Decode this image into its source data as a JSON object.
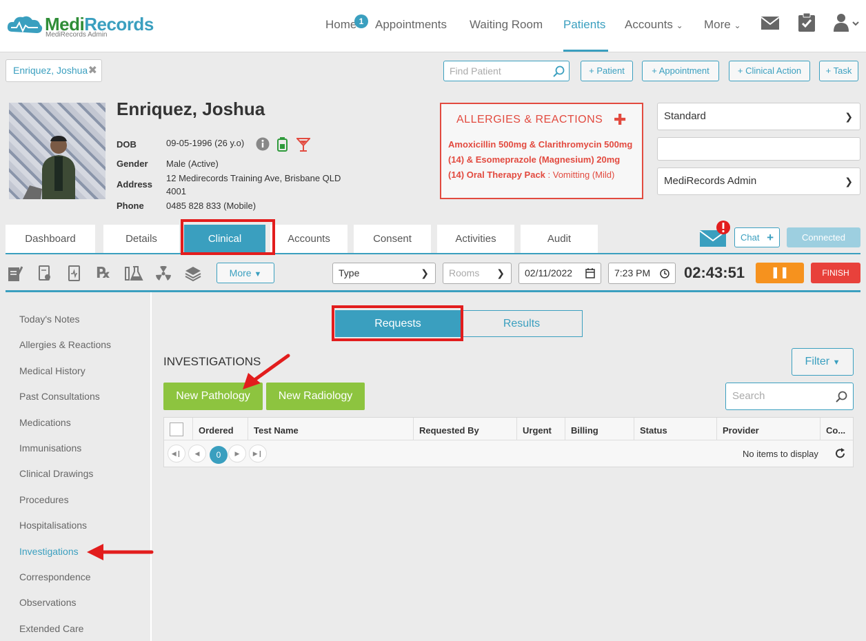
{
  "brand": {
    "name_part1": "Medi",
    "name_part2": "Records",
    "subtitle": "MediRecords Admin"
  },
  "nav": {
    "home": "Home",
    "home_badge": "1",
    "appointments": "Appointments",
    "waiting_room": "Waiting Room",
    "patients": "Patients",
    "accounts": "Accounts",
    "more": "More"
  },
  "toolbar": {
    "patient_tab": "Enriquez, Joshua",
    "find_patient_placeholder": "Find Patient",
    "add_patient": "+ Patient",
    "add_appointment": "+ Appointment",
    "add_clinical_action": "+ Clinical Action",
    "add_task": "+ Task"
  },
  "patient": {
    "name": "Enriquez, Joshua",
    "dob_label": "DOB",
    "dob": "09-05-1996 (26 y.o)",
    "gender_label": "Gender",
    "gender": "Male (Active)",
    "address_label": "Address",
    "address_line1": "12 Medirecords Training Ave, Brisbane QLD",
    "address_line2": "4001",
    "phone_label": "Phone",
    "phone": "0485 828 833 (Mobile)"
  },
  "allergies": {
    "title": "ALLERGIES & REACTIONS",
    "drug": "Amoxicillin 500mg & Clarithromycin 500mg (14) & Esomeprazole (Magnesium) 20mg (14) Oral Therapy Pack",
    "reaction": " : Vomitting (Mild)"
  },
  "right_selects": {
    "billing_type": "Standard",
    "blank": "",
    "provider": "MediRecords Admin"
  },
  "tabs": [
    "Dashboard",
    "Details",
    "Clinical",
    "Accounts",
    "Consent",
    "Activities",
    "Audit"
  ],
  "chat": {
    "label": "Chat",
    "connected": "Connected"
  },
  "clinical_toolbar": {
    "more": "More",
    "type": "Type",
    "rooms": "Rooms",
    "date": "02/11/2022",
    "time": "7:23 PM",
    "timer": "02:43:51",
    "finish": "FINISH"
  },
  "sidebar": [
    "Today's Notes",
    "Allergies & Reactions",
    "Medical History",
    "Past Consultations",
    "Medications",
    "Immunisations",
    "Clinical Drawings",
    "Procedures",
    "Hospitalisations",
    "Investigations",
    "Correspondence",
    "Observations",
    "Extended Care"
  ],
  "main": {
    "requests": "Requests",
    "results": "Results",
    "title": "INVESTIGATIONS",
    "filter": "Filter",
    "new_pathology": "New Pathology",
    "new_radiology": "New Radiology",
    "search_placeholder": "Search",
    "columns": [
      "Ordered",
      "Test Name",
      "Requested By",
      "Urgent",
      "Billing",
      "Status",
      "Provider",
      "Co..."
    ],
    "page": "0",
    "no_items": "No items to display"
  },
  "colors": {
    "accent": "#3a9fbf",
    "green": "#8dc43f",
    "alert": "#e24a3f",
    "pause": "#f6921e",
    "annotation": "#e21d1d"
  }
}
